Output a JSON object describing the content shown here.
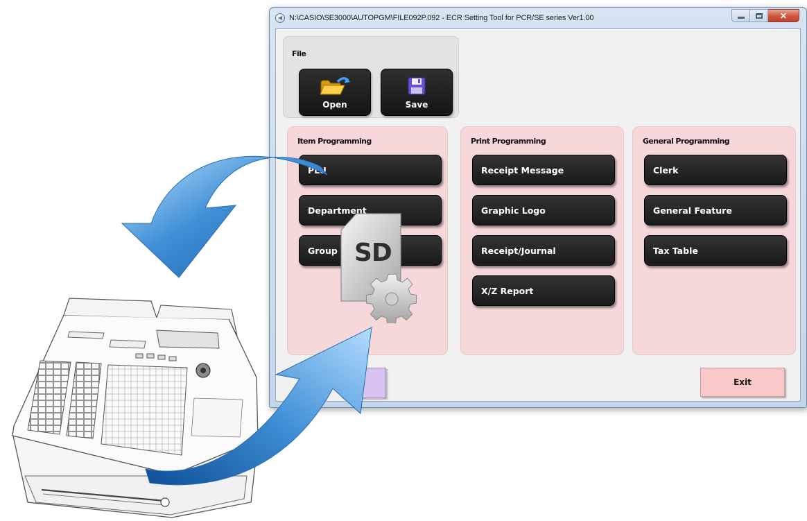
{
  "window": {
    "title": "N:\\CASIO\\SE3000\\AUTOPGM\\FILE092P.092 - ECR Setting Tool for PCR/SE series Ver1.00"
  },
  "file_group": {
    "title": "File",
    "open_label": "Open",
    "save_label": "Save"
  },
  "item_programming": {
    "title": "Item Programming",
    "buttons": [
      "PLU",
      "Department",
      "Group"
    ]
  },
  "print_programming": {
    "title": "Print Programming",
    "buttons": [
      "Receipt Message",
      "Graphic Logo",
      "Receipt/Journal",
      "X/Z Report"
    ]
  },
  "general_programming": {
    "title": "General Programming",
    "buttons": [
      "Clerk",
      "General Feature",
      "Tax Table"
    ]
  },
  "footer": {
    "exit_label": "Exit"
  },
  "artwork": {
    "sd_card_label": "SD",
    "sd_card_icon": "sd-card-gear-icon",
    "arrows_icon": "transfer-arrows-icon",
    "register_icon": "cash-register-icon"
  },
  "colors": {
    "button_dark": "#222222",
    "group_pink": "#f6d7da",
    "exit_pink": "#f9c9ca",
    "arrow_blue": "#3f8fd6"
  }
}
